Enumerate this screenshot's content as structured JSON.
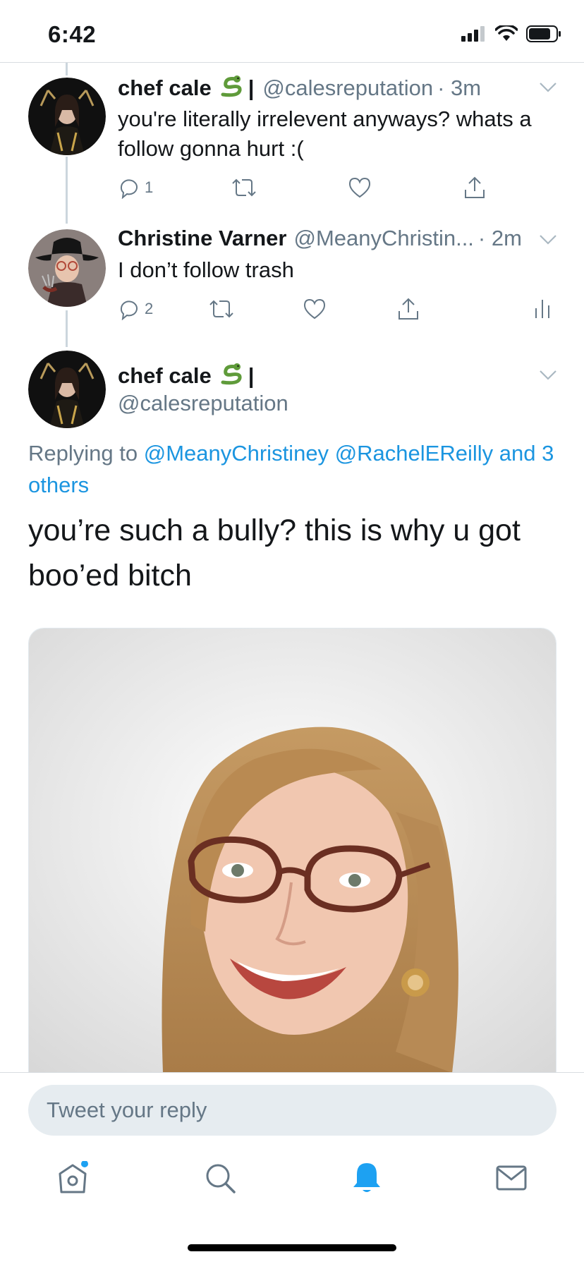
{
  "status_bar": {
    "time": "6:42"
  },
  "tweets": [
    {
      "name": "chef cale",
      "name_suffix": "|",
      "handle": "@calesreputation",
      "time": "· 3m",
      "text": "you're literally irrelevent anyways? whats a follow gonna hurt :(",
      "reply_count": "1",
      "avatar": "chef-cale-avatar"
    },
    {
      "name": "Christine Varner",
      "handle": "@MeanyChristin...",
      "time": "· 2m",
      "text": "I don’t follow trash",
      "reply_count": "2",
      "avatar": "christine-varner-avatar"
    }
  ],
  "main_tweet": {
    "name": "chef cale",
    "name_suffix": "|",
    "handle": "@calesreputation",
    "replying_label": "Replying to",
    "mention_1": "@MeanyChristiney",
    "mention_2": "@RachelEReilly",
    "and_label": "and",
    "others_label": "3 others",
    "text": "you’re such a bully? this is why u got boo’ed bitch"
  },
  "reply_box": {
    "placeholder": "Tweet your reply"
  },
  "tabbar": {
    "items": [
      "home-icon",
      "search-icon",
      "notifications-icon",
      "messages-icon"
    ],
    "active": "notifications-icon"
  },
  "colors": {
    "accent": "#1da1f2",
    "link": "#1b95e0",
    "secondary_text": "#657786",
    "divider": "#d8dde1"
  }
}
